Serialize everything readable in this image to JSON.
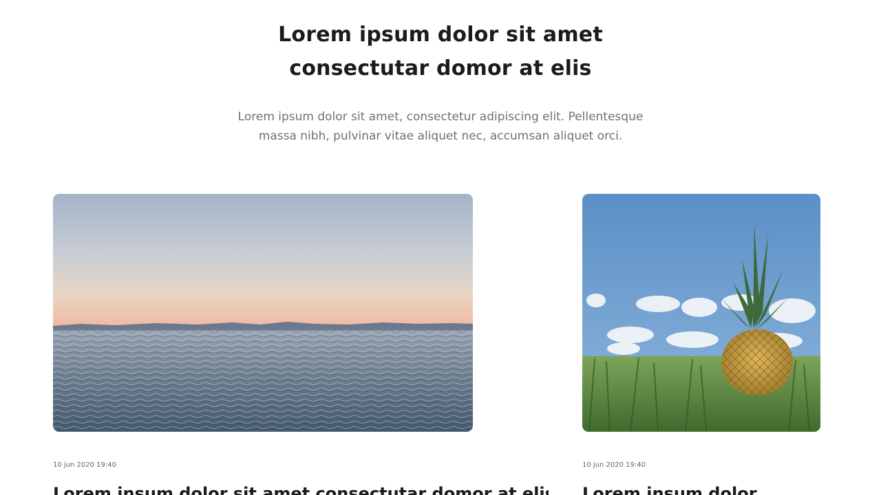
{
  "section": {
    "heading_line1": "Lorem ipsum dolor sit amet",
    "heading_line2": "consectutar domor at elis",
    "subtitle_line1": "Lorem ipsum dolor sit amet, consectetur adipiscing elit. Pellentesque",
    "subtitle_line2": "massa nibh, pulvinar vitae aliquet nec, accumsan aliquet orci."
  },
  "cards": [
    {
      "image": "sea-sunset-photo",
      "date": "10 jun 2020 19:40",
      "title": "Lorem insum dolor sit amet consectutar domor at elis"
    },
    {
      "image": "pineapple-grass-photo",
      "date": "10 jun 2020 19:40",
      "title": "Lorem insum dolor"
    }
  ],
  "colors": {
    "heading": "#1b1b1b",
    "subtitle": "#6b7079",
    "date": "#5f6368",
    "background": "#ffffff"
  }
}
